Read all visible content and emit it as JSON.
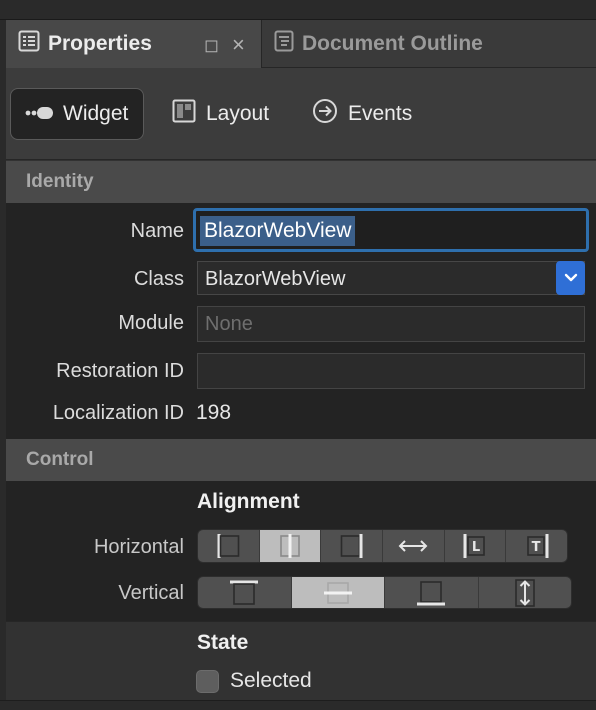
{
  "tabs": {
    "properties_label": "Properties",
    "document_outline_label": "Document Outline",
    "minimize_glyph": "◻",
    "close_glyph": "×"
  },
  "switcher": {
    "widget_label": "Widget",
    "layout_label": "Layout",
    "events_label": "Events",
    "active": "Widget"
  },
  "identity": {
    "header": "Identity",
    "name_label": "Name",
    "name_value": "BlazorWebView",
    "class_label": "Class",
    "class_value": "BlazorWebView",
    "module_label": "Module",
    "module_placeholder": "None",
    "restoration_label": "Restoration ID",
    "restoration_value": "",
    "localization_label": "Localization ID",
    "localization_value": "198"
  },
  "control": {
    "header": "Control",
    "alignment_title": "Alignment",
    "horizontal_label": "Horizontal",
    "horizontal_options": [
      "left",
      "center",
      "right",
      "fill",
      "leading",
      "trailing"
    ],
    "horizontal_selected": "center",
    "vertical_label": "Vertical",
    "vertical_options": [
      "top",
      "center",
      "bottom",
      "fill"
    ],
    "vertical_selected": "center"
  },
  "state": {
    "title": "State",
    "selected_label": "Selected",
    "selected_checked": false
  },
  "icons": {
    "properties": "properties-list-icon",
    "document_outline": "outline-doc-icon",
    "widget": "widget-toggle-icon",
    "layout": "layout-panel-icon",
    "events": "arrow-circle-icon",
    "dropdown": "chevron-down-icon"
  },
  "colors": {
    "accent_blue": "#2f6fd6",
    "focus_ring": "#2e6fad",
    "selection_bg": "#3b5f8a",
    "active_segment": "#bdbdbd"
  }
}
